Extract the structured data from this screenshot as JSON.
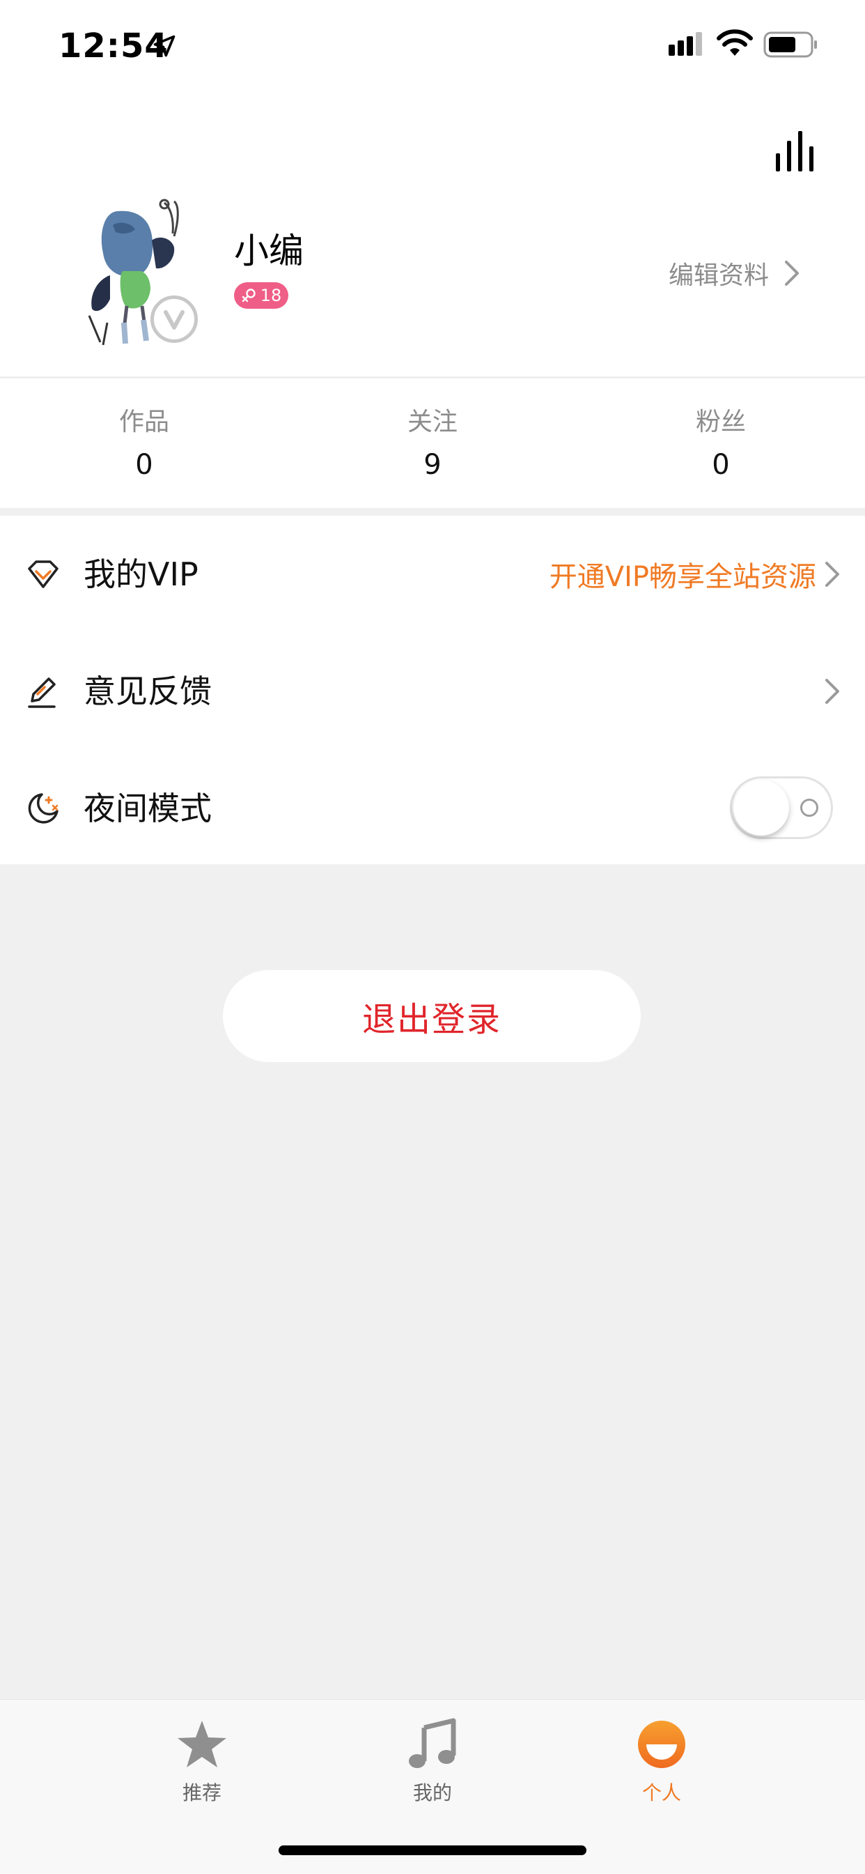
{
  "status_bar": {
    "time": "12:54",
    "icons": [
      "location-arrow-icon",
      "cellular-signal-icon",
      "wifi-icon",
      "battery-icon"
    ]
  },
  "profile": {
    "username": "小编",
    "gender_age": "18",
    "gender_icon": "female-icon",
    "verified_icon": "v-badge-icon",
    "edit_label": "编辑资料"
  },
  "stats": [
    {
      "label": "作品",
      "value": "0"
    },
    {
      "label": "关注",
      "value": "9"
    },
    {
      "label": "粉丝",
      "value": "0"
    }
  ],
  "menu": {
    "vip": {
      "label": "我的VIP",
      "promo": "开通VIP畅享全站资源",
      "icon": "diamond-icon"
    },
    "feedback": {
      "label": "意见反馈",
      "icon": "pencil-icon"
    },
    "night_mode": {
      "label": "夜间模式",
      "icon": "moon-icon",
      "enabled": false
    }
  },
  "logout_label": "退出登录",
  "tabbar": {
    "tabs": [
      {
        "label": "推荐",
        "icon": "star-icon",
        "active": false
      },
      {
        "label": "我的",
        "icon": "music-note-icon",
        "active": false
      },
      {
        "label": "个人",
        "icon": "smile-face-icon",
        "active": true
      }
    ]
  },
  "colors": {
    "accent": "#f07a24",
    "logout_text": "#e0252b",
    "gender_badge": "#ef5e87",
    "background": "#f0f0f0"
  }
}
